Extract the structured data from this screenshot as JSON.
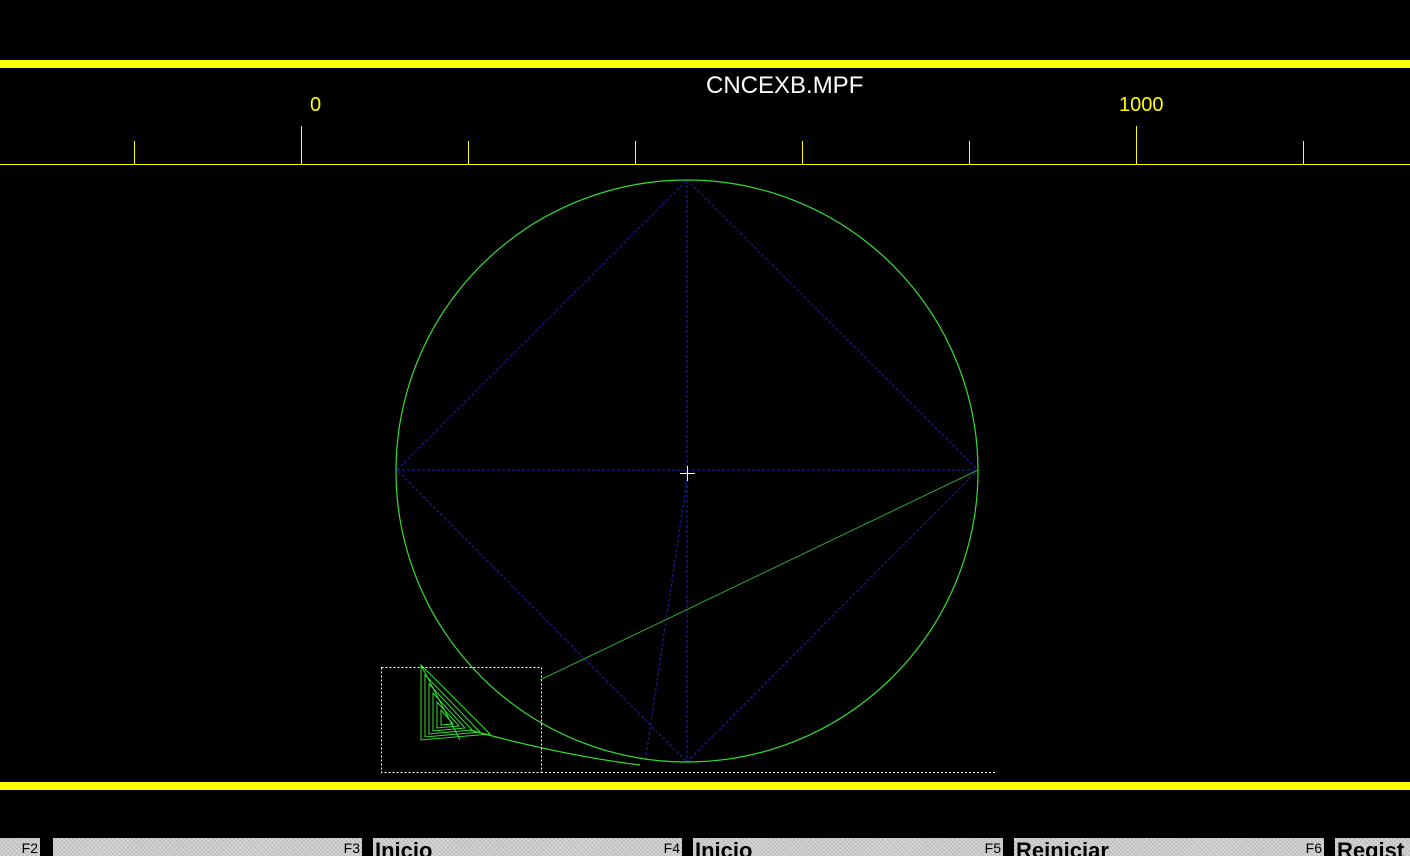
{
  "title": "CNCEXB.MPF",
  "ruler": {
    "labels": [
      "0",
      "1000"
    ]
  },
  "softkeys": [
    {
      "fn": "F2",
      "label": ""
    },
    {
      "fn": "F3",
      "label": ""
    },
    {
      "fn": "F4",
      "label": "Inicio"
    },
    {
      "fn": "F5",
      "label": "Reiniciar"
    },
    {
      "fn": "F6",
      "label": "Regist"
    }
  ],
  "colors": {
    "background": "#000000",
    "frame": "#ffff00",
    "ruler": "#ffff00",
    "toolpath": "#33dd33",
    "rapid_moves": "#1a1a99",
    "crosshair": "#ffffff",
    "title": "#ffffff"
  }
}
